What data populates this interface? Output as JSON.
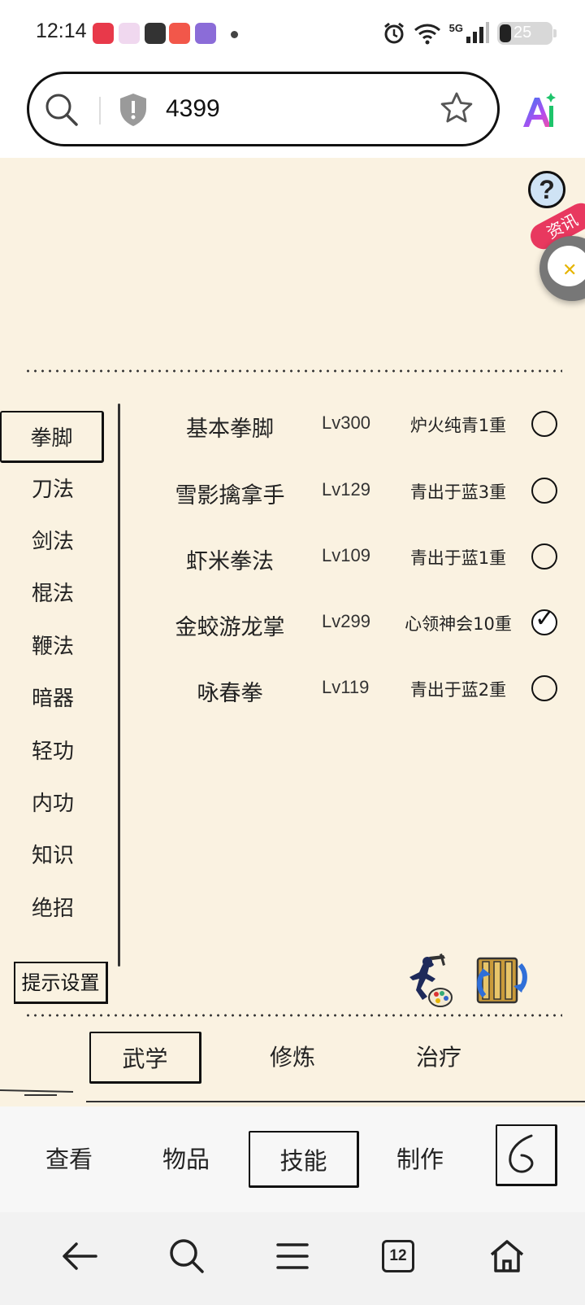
{
  "status_bar": {
    "time": "12:14",
    "network": "5G",
    "battery": "25"
  },
  "address_bar": {
    "url_text": "4399"
  },
  "news_badge": "资讯",
  "help_label": "?",
  "categories": [
    {
      "label": "拳脚",
      "selected": true
    },
    {
      "label": "刀法",
      "selected": false
    },
    {
      "label": "剑法",
      "selected": false
    },
    {
      "label": "棍法",
      "selected": false
    },
    {
      "label": "鞭法",
      "selected": false
    },
    {
      "label": "暗器",
      "selected": false
    },
    {
      "label": "轻功",
      "selected": false
    },
    {
      "label": "内功",
      "selected": false
    },
    {
      "label": "知识",
      "selected": false
    },
    {
      "label": "绝招",
      "selected": false
    }
  ],
  "hint_settings": "提示设置",
  "skills": [
    {
      "name": "基本拳脚",
      "level": "Lv300",
      "realm": "炉火纯青1重",
      "checked": false
    },
    {
      "name": "雪影擒拿手",
      "level": "Lv129",
      "realm": "青出于蓝3重",
      "checked": false
    },
    {
      "name": "虾米拳法",
      "level": "Lv109",
      "realm": "青出于蓝1重",
      "checked": false
    },
    {
      "name": "金蛟游龙掌",
      "level": "Lv299",
      "realm": "心领神会10重",
      "checked": true
    },
    {
      "name": "咏春拳",
      "level": "Lv119",
      "realm": "青出于蓝2重",
      "checked": false
    }
  ],
  "subtabs": [
    {
      "label": "武学",
      "selected": true
    },
    {
      "label": "修炼",
      "selected": false
    },
    {
      "label": "治疗",
      "selected": false
    }
  ],
  "bottom_nav": [
    {
      "label": "查看",
      "selected": false
    },
    {
      "label": "物品",
      "selected": false
    },
    {
      "label": "技能",
      "selected": true
    },
    {
      "label": "制作",
      "selected": false
    }
  ],
  "system_nav": {
    "tab_count": "12"
  },
  "colors": {
    "background": "#faf2e1",
    "ink": "#111111",
    "news_badge": "#e8385f"
  }
}
